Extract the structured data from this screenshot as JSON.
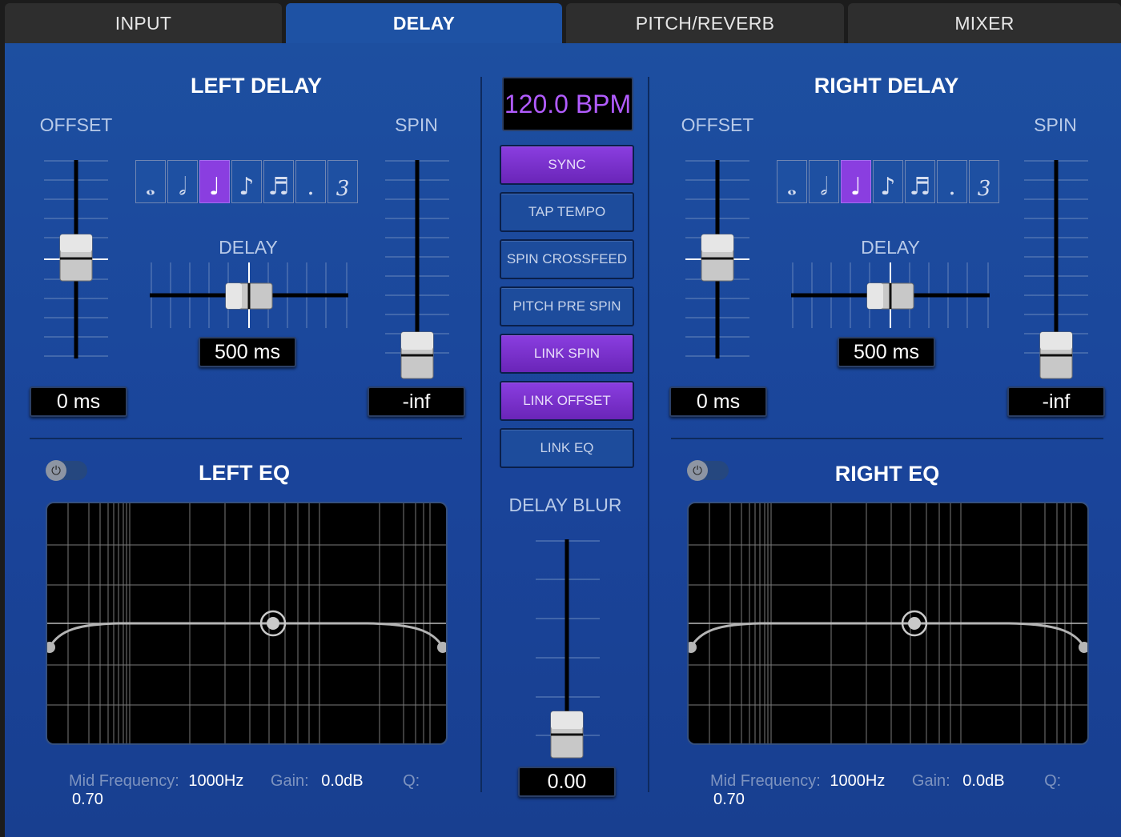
{
  "tabs": [
    {
      "label": "INPUT",
      "active": false
    },
    {
      "label": "DELAY",
      "active": true
    },
    {
      "label": "PITCH/REVERB",
      "active": false
    },
    {
      "label": "MIXER",
      "active": false
    }
  ],
  "left": {
    "title": "LEFT DELAY",
    "offset_label": "OFFSET",
    "spin_label": "SPIN",
    "delay_label": "DELAY",
    "offset_value": "0 ms",
    "spin_value": "-inf",
    "delay_value": "500 ms",
    "selected_note_index": 2,
    "eq": {
      "title": "LEFT EQ",
      "freq_label": "Mid Frequency:",
      "freq_value": "1000Hz",
      "gain_label": "Gain:",
      "gain_value": "0.0dB",
      "q_label": "Q:",
      "q_value": "0.70"
    }
  },
  "right": {
    "title": "RIGHT DELAY",
    "offset_label": "OFFSET",
    "spin_label": "SPIN",
    "delay_label": "DELAY",
    "offset_value": "0 ms",
    "spin_value": "-inf",
    "delay_value": "500 ms",
    "selected_note_index": 2,
    "eq": {
      "title": "RIGHT EQ",
      "freq_label": "Mid Frequency:",
      "freq_value": "1000Hz",
      "gain_label": "Gain:",
      "gain_value": "0.0dB",
      "q_label": "Q:",
      "q_value": "0.70"
    }
  },
  "note_symbols": [
    "whole-note",
    "half-note",
    "quarter-note",
    "eighth-note",
    "sixteenth-note",
    "dot",
    "triplet"
  ],
  "note_glyphs": [
    "𝅝",
    "𝅗𝅥",
    "♩",
    "♪",
    "♬",
    ".",
    "3"
  ],
  "center": {
    "bpm": "120.0 BPM",
    "buttons": [
      {
        "label": "SYNC",
        "on": true
      },
      {
        "label": "TAP TEMPO",
        "on": false
      },
      {
        "label": "SPIN CROSSFEED",
        "on": false
      },
      {
        "label": "PITCH PRE SPIN",
        "on": false
      },
      {
        "label": "LINK SPIN",
        "on": true
      },
      {
        "label": "LINK OFFSET",
        "on": true
      },
      {
        "label": "LINK EQ",
        "on": false
      }
    ],
    "blur_label": "DELAY BLUR",
    "blur_value": "0.00"
  },
  "colors": {
    "accent": "#8a3ee0",
    "panel": "#1d4fa0",
    "bpm_text": "#b25cff"
  }
}
